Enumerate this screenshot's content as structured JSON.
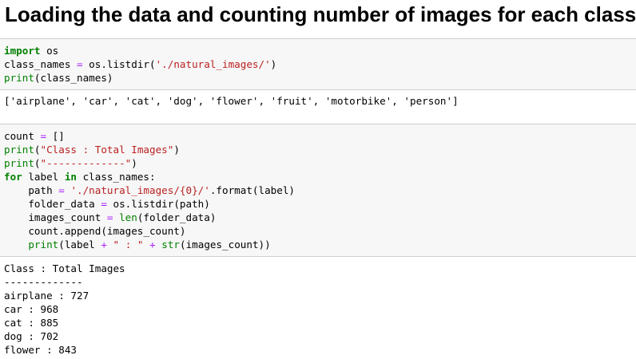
{
  "heading": "Loading the data and counting number of images for each class",
  "cell1": {
    "line1": {
      "kw": "import",
      "rest": " os"
    },
    "line2": {
      "a": "class_names ",
      "op": "=",
      "b": " os.listdir(",
      "str": "'./natural_images/'",
      "c": ")"
    },
    "line3": {
      "bi": "print",
      "rest": "(class_names)"
    }
  },
  "output1": "['airplane', 'car', 'cat', 'dog', 'flower', 'fruit', 'motorbike', 'person']",
  "cell2": {
    "line1": {
      "a": "count ",
      "op": "=",
      "b": " []"
    },
    "line2": {
      "bi": "print",
      "a": "(",
      "str": "\"Class : Total Images\"",
      "b": ")"
    },
    "line3": {
      "bi": "print",
      "a": "(",
      "str": "\"-------------\"",
      "b": ")"
    },
    "line4": {
      "kw1": "for",
      "a": " label ",
      "kw2": "in",
      "b": " class_names:"
    },
    "line5": {
      "a": "    path ",
      "op": "=",
      "b": " ",
      "str": "'./natural_images/{0}/'",
      "c": ".format(label)"
    },
    "line6": {
      "a": "    folder_data ",
      "op": "=",
      "b": " os.listdir(path)"
    },
    "line7": {
      "a": "    images_count ",
      "op": "=",
      "b": " ",
      "bi": "len",
      "c": "(folder_data)"
    },
    "line8": {
      "a": "    count.append(images_count)"
    },
    "line9": {
      "a": "    ",
      "bi1": "print",
      "b": "(label ",
      "op1": "+",
      "c": " ",
      "str": "\" : \"",
      "d": " ",
      "op2": "+",
      "e": " ",
      "bi2": "str",
      "f": "(images_count))"
    }
  },
  "output2": {
    "lines": [
      "Class : Total Images",
      "-------------",
      "airplane : 727",
      "car : 968",
      "cat : 885",
      "dog : 702",
      "flower : 843"
    ]
  }
}
